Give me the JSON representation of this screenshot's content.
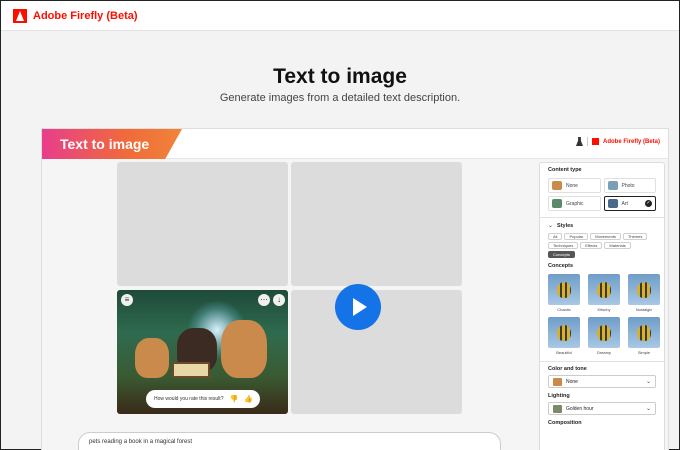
{
  "topbar": {
    "brand": "Adobe Firefly (Beta)"
  },
  "hero": {
    "title": "Text to image",
    "subtitle": "Generate images from a detailed text description."
  },
  "frame": {
    "banner": "Text to image",
    "head_brand": "Adobe Firefly (Beta)",
    "rate_prompt": "How would you rate this result?",
    "prompt_text": "pets reading a book in a magical forest"
  },
  "panel": {
    "content_type_label": "Content type",
    "content_types": [
      "None",
      "Photo",
      "Graphic",
      "Art"
    ],
    "selected_content_type": "Art",
    "styles_label": "Styles",
    "style_chips": [
      "All",
      "Popular",
      "Movements",
      "Themes",
      "Techniques",
      "Effects",
      "Materials",
      "Concepts"
    ],
    "active_chip": "Concepts",
    "concepts_label": "Concepts",
    "concepts": [
      "Chaotic",
      "Kitschy",
      "Nostalgic",
      "Beautiful",
      "Dreamy",
      "Simple"
    ],
    "color_tone_label": "Color and tone",
    "color_tone_value": "None",
    "lighting_label": "Lighting",
    "lighting_value": "Golden hour",
    "composition_label": "Composition"
  },
  "colors": {
    "brand_red": "#fa0f00",
    "play_blue": "#1473e6"
  }
}
